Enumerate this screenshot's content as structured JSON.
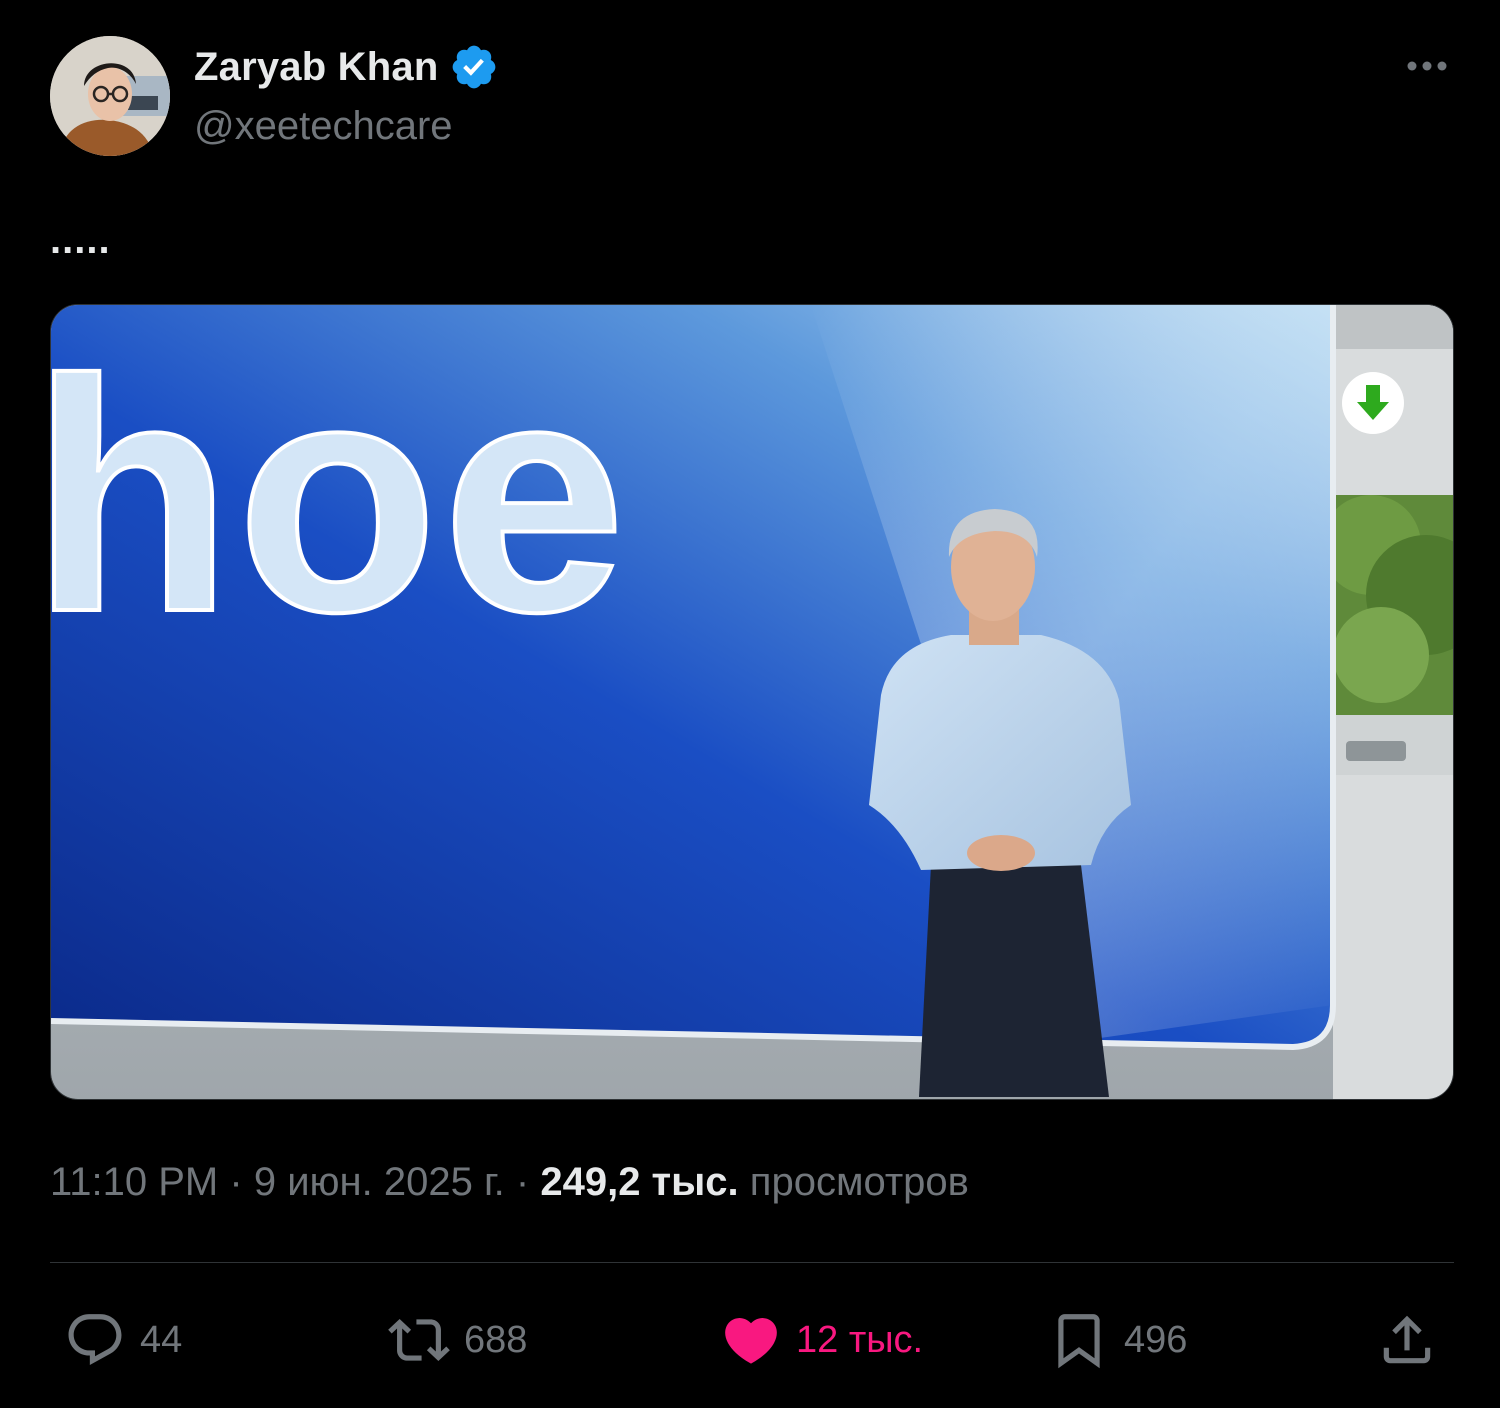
{
  "author": {
    "name": "Zaryab Khan",
    "handle": "@xeetechcare",
    "verified_badge_icon": "verified-badge-icon",
    "avatar": "profile-photo"
  },
  "tweet": {
    "text": ".....",
    "media": {
      "headline_text": "hoe",
      "overlay_icon": "download-arrow-icon"
    }
  },
  "meta": {
    "time": "11:10 PM",
    "separator": "·",
    "date": "9 июн. 2025 г.",
    "views_count": "249,2 тыс.",
    "views_label": "просмотров"
  },
  "actions": {
    "reply": {
      "icon": "reply-icon",
      "count": "44"
    },
    "repost": {
      "icon": "repost-icon",
      "count": "688"
    },
    "like": {
      "icon": "heart-icon",
      "count": "12 тыс.",
      "active": true
    },
    "bookmark": {
      "icon": "bookmark-icon",
      "count": "496"
    },
    "share": {
      "icon": "share-icon"
    }
  },
  "colors": {
    "background": "#000000",
    "primary_text": "#e7e9ea",
    "secondary_text": "#71767b",
    "verified": "#1d9bf0",
    "like": "#f91880",
    "divider": "#2f3336"
  }
}
